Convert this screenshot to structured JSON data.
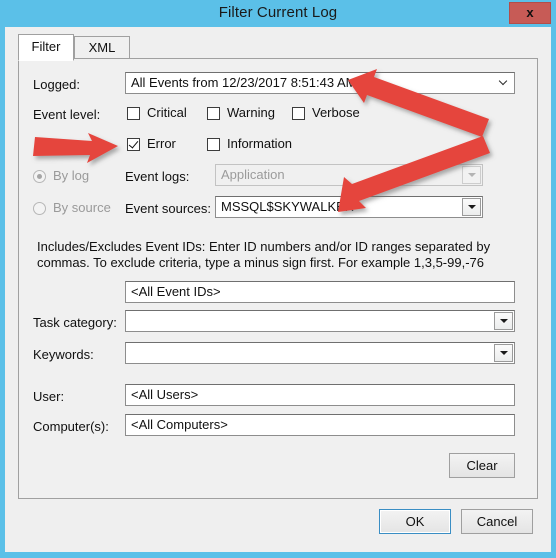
{
  "window": {
    "title": "Filter Current Log",
    "close_label": "x",
    "frame_color": "#5bc0e8",
    "close_color": "#c75b56"
  },
  "tabs": [
    {
      "label": "Filter",
      "active": true
    },
    {
      "label": "XML",
      "active": false
    }
  ],
  "form": {
    "logged": {
      "label": "Logged:",
      "value": "All Events from 12/23/2017 8:51:43 AM"
    },
    "event_level": {
      "label": "Event level:",
      "options": [
        {
          "label": "Critical",
          "checked": false
        },
        {
          "label": "Warning",
          "checked": false
        },
        {
          "label": "Verbose",
          "checked": false
        },
        {
          "label": "Error",
          "checked": true
        },
        {
          "label": "Information",
          "checked": false
        }
      ]
    },
    "source_mode": {
      "by_log": {
        "label": "By log",
        "selected": true,
        "disabled": true
      },
      "by_source": {
        "label": "By source",
        "selected": false,
        "disabled": true
      }
    },
    "event_logs": {
      "label": "Event logs:",
      "value": "Application",
      "disabled": true
    },
    "event_sources": {
      "label": "Event sources:",
      "value": "MSSQL$SKYWALKER",
      "disabled": false
    },
    "event_ids": {
      "help": "Includes/Excludes Event IDs: Enter ID numbers and/or ID ranges separated by commas. To exclude criteria, type a minus sign first. For example 1,3,5-99,-76",
      "value": "<All Event IDs>"
    },
    "task_category": {
      "label": "Task category:",
      "value": ""
    },
    "keywords": {
      "label": "Keywords:",
      "value": ""
    },
    "user": {
      "label": "User:",
      "value": "<All Users>"
    },
    "computers": {
      "label": "Computer(s):",
      "value": "<All Computers>"
    }
  },
  "buttons": {
    "clear": "Clear",
    "ok": "OK",
    "cancel": "Cancel"
  },
  "annotations": {
    "color": "#e5443c",
    "arrows": [
      {
        "name": "arrow-to-logged-field",
        "target": "logged-combobox"
      },
      {
        "name": "arrow-to-error-checkbox",
        "target": "checkbox-error"
      },
      {
        "name": "arrow-to-event-sources",
        "target": "event-sources-combobox"
      }
    ]
  }
}
